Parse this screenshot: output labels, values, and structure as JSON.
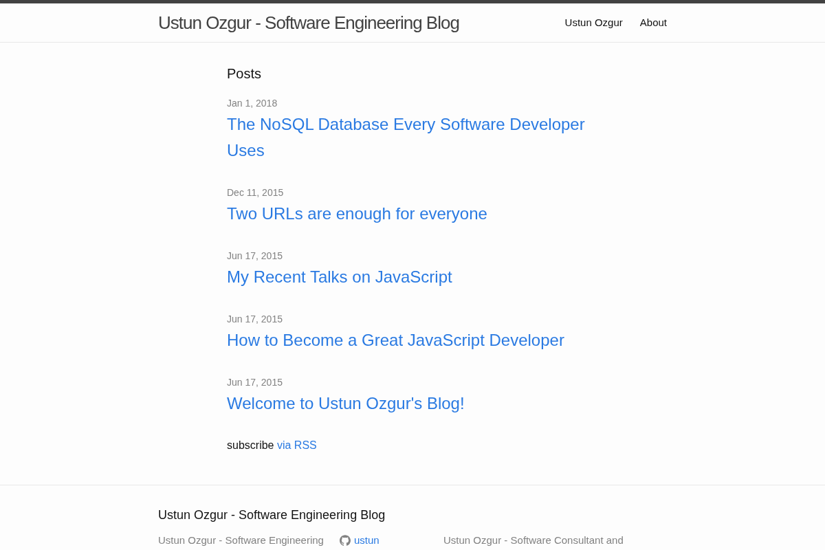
{
  "header": {
    "site_title": "Ustun Ozgur - Software Engineering Blog",
    "nav_links": [
      "Ustun Ozgur",
      "About"
    ]
  },
  "main": {
    "heading": "Posts",
    "posts": [
      {
        "date": "Jan 1, 2018",
        "title": "The NoSQL Database Every Software Developer Uses"
      },
      {
        "date": "Dec 11, 2015",
        "title": "Two URLs are enough for everyone"
      },
      {
        "date": "Jun 17, 2015",
        "title": "My Recent Talks on JavaScript"
      },
      {
        "date": "Jun 17, 2015",
        "title": "How to Become a Great JavaScript Developer"
      },
      {
        "date": "Jun 17, 2015",
        "title": "Welcome to Ustun Ozgur's Blog!"
      }
    ],
    "subscribe": {
      "text": "subscribe",
      "link": "via RSS"
    }
  },
  "footer": {
    "heading": "Ustun Ozgur - Software Engineering Blog",
    "column_1": "Ustun Ozgur - Software Engineering",
    "github_username": "ustun",
    "column_3": "Ustun Ozgur - Software Consultant and"
  }
}
